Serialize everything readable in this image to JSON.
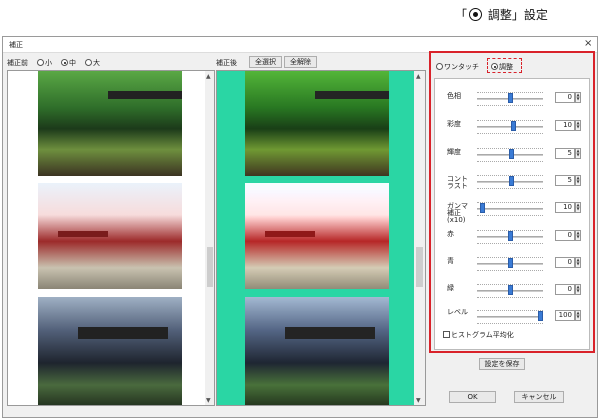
{
  "callout": {
    "prefix": "「",
    "suffix": "調整」設定"
  },
  "window": {
    "title": "補正",
    "close": "×"
  },
  "before": {
    "label": "補正前",
    "sizes": [
      {
        "label": "小",
        "selected": false
      },
      {
        "label": "中",
        "selected": true
      },
      {
        "label": "大",
        "selected": false
      }
    ]
  },
  "after": {
    "label": "補正後",
    "select_all": "全選択",
    "deselect_all": "全解除"
  },
  "mode": {
    "onetouch": "ワンタッチ",
    "adjust": "調整",
    "selected": "adjust"
  },
  "sliders": [
    {
      "label": "色相",
      "value": "0",
      "level": 0.5
    },
    {
      "label": "彩度",
      "value": "10",
      "level": 0.55
    },
    {
      "label": "輝度",
      "value": "5",
      "level": 0.52
    },
    {
      "label": "コント\nラスト",
      "value": "5",
      "level": 0.52
    },
    {
      "label": "ガンマ\n補正\n(x10)",
      "value": "10",
      "level": 0.05
    },
    {
      "label": "赤",
      "value": "0",
      "level": 0.5
    },
    {
      "label": "青",
      "value": "0",
      "level": 0.5
    },
    {
      "label": "緑",
      "value": "0",
      "level": 0.5
    }
  ],
  "histogram": {
    "label": "ヒストグラム平均化",
    "checked": false
  },
  "level": {
    "label": "レベル",
    "value": "100",
    "level": 1.0
  },
  "buttons": {
    "save": "設定を保存",
    "ok": "OK",
    "cancel": "キャンセル"
  },
  "colors": {
    "accent": "#d9222a",
    "preview_bg": "#2ad6a4",
    "slider": "#3a7bd5"
  }
}
